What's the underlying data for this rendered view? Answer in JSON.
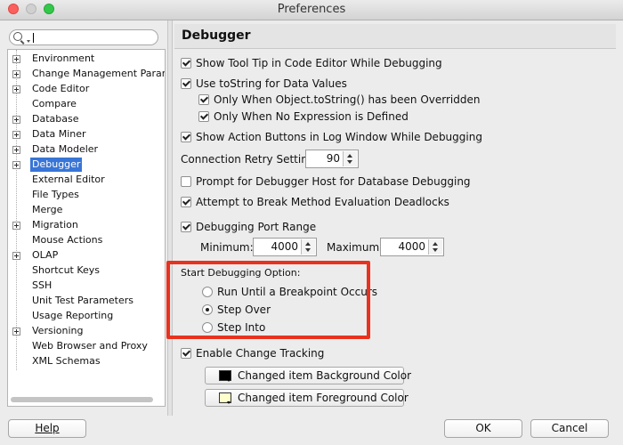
{
  "window": {
    "title": "Preferences"
  },
  "search": {
    "placeholder": "",
    "value": ""
  },
  "tree": {
    "items": [
      {
        "label": "Environment",
        "expandable": true
      },
      {
        "label": "Change Management Param",
        "expandable": true
      },
      {
        "label": "Code Editor",
        "expandable": true
      },
      {
        "label": "Compare",
        "expandable": false
      },
      {
        "label": "Database",
        "expandable": true
      },
      {
        "label": "Data Miner",
        "expandable": true
      },
      {
        "label": "Data Modeler",
        "expandable": true
      },
      {
        "label": "Debugger",
        "expandable": true,
        "selected": true
      },
      {
        "label": "External Editor",
        "expandable": false
      },
      {
        "label": "File Types",
        "expandable": false
      },
      {
        "label": "Merge",
        "expandable": false
      },
      {
        "label": "Migration",
        "expandable": true
      },
      {
        "label": "Mouse Actions",
        "expandable": false
      },
      {
        "label": "OLAP",
        "expandable": true
      },
      {
        "label": "Shortcut Keys",
        "expandable": false
      },
      {
        "label": "SSH",
        "expandable": false
      },
      {
        "label": "Unit Test Parameters",
        "expandable": false
      },
      {
        "label": "Usage Reporting",
        "expandable": false
      },
      {
        "label": "Versioning",
        "expandable": true
      },
      {
        "label": "Web Browser and Proxy",
        "expandable": false
      },
      {
        "label": "XML Schemas",
        "expandable": false
      }
    ]
  },
  "panel": {
    "title": "Debugger",
    "options": {
      "show_tooltip": {
        "label": "Show Tool Tip in Code Editor While Debugging",
        "checked": true
      },
      "use_tostring": {
        "label": "Use toString for Data Values",
        "checked": true
      },
      "only_overridden": {
        "label": "Only When Object.toString() has been Overridden",
        "checked": true
      },
      "only_no_expression": {
        "label": "Only When No Expression is Defined",
        "checked": true
      },
      "show_action_buttons": {
        "label": "Show Action Buttons in Log Window While Debugging",
        "checked": true
      },
      "prompt_host": {
        "label": "Prompt for Debugger Host for Database Debugging",
        "checked": false
      },
      "attempt_break": {
        "label": "Attempt to Break Method Evaluation Deadlocks",
        "checked": true
      },
      "port_range": {
        "label": "Debugging Port Range",
        "checked": true
      },
      "change_tracking": {
        "label": "Enable Change Tracking",
        "checked": true
      }
    },
    "connection_retry": {
      "label": "Connection Retry Setting:",
      "value": "90"
    },
    "port_min": {
      "label": "Minimum:",
      "value": "4000"
    },
    "port_max": {
      "label": "Maximum:",
      "value": "4000"
    },
    "start_option": {
      "label": "Start Debugging Option:",
      "choices": [
        {
          "label": "Run Until a Breakpoint Occurs",
          "selected": false
        },
        {
          "label": "Step Over",
          "selected": true
        },
        {
          "label": "Step Into",
          "selected": false
        }
      ]
    },
    "color_buttons": {
      "background": {
        "label": "Changed item Background Color",
        "swatch": "#000000"
      },
      "foreground": {
        "label": "Changed item Foreground Color",
        "swatch": "#ffffcc"
      }
    }
  },
  "footer": {
    "help": "Help",
    "ok": "OK",
    "cancel": "Cancel"
  },
  "colors": {
    "highlight": "#e8321f",
    "selection": "#3875d7"
  }
}
